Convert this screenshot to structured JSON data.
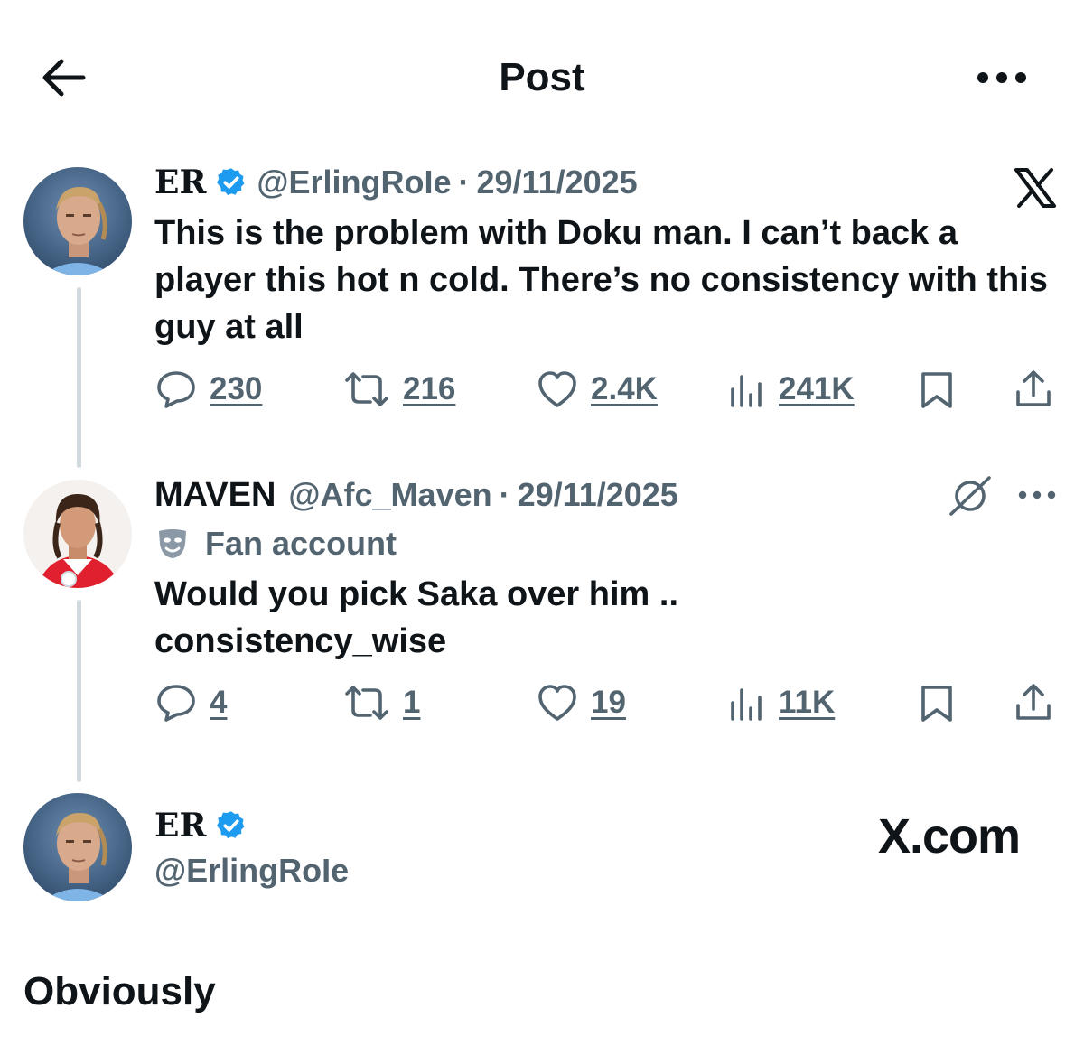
{
  "header": {
    "title": "Post",
    "back_icon": "arrow-left-icon",
    "more_icon": "more-horizontal-icon"
  },
  "colors": {
    "text": "#0f1419",
    "muted": "#536471",
    "verified": "#1d9bf0",
    "thread_line": "#cfd9de"
  },
  "tweets": [
    {
      "display_name": "ER",
      "handle": "@ErlingRoIe",
      "separator": "·",
      "date": "29/11/2025",
      "verified": true,
      "corner_icon": "x-logo-icon",
      "text": "This is the problem with Doku man. I can’t back a player this hot n cold. There’s no consistency with this guy at all",
      "stats": {
        "replies": "230",
        "reposts": "216",
        "likes": "2.4K",
        "views": "241K"
      }
    },
    {
      "display_name": "MAVEN",
      "handle": "@Afc_Maven",
      "separator": "·",
      "date": "29/11/2025",
      "verified": false,
      "label": "Fan account",
      "label_icon": "mask-icon",
      "corner_icon": "grok-icon",
      "text": "Would you pick Saka over him .. consistency_wise",
      "stats": {
        "replies": "4",
        "reposts": "1",
        "likes": "19",
        "views": "11K"
      }
    }
  ],
  "reply": {
    "display_name": "ER",
    "handle": "@ErlingRoIe",
    "verified": true,
    "brand": "X.com",
    "text": "Obviously"
  }
}
